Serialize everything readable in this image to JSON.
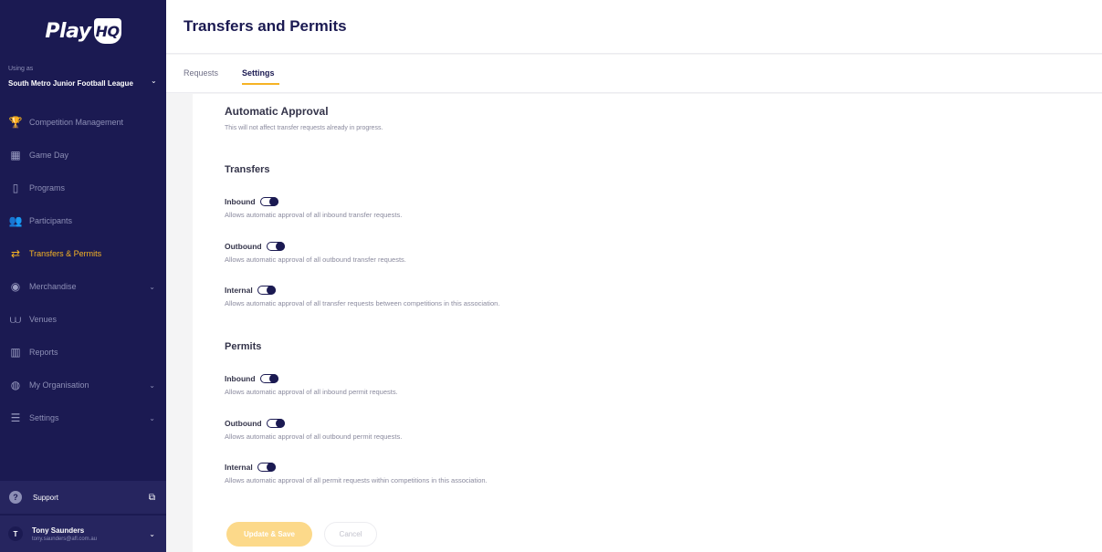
{
  "brand": {
    "logo_text": "Play",
    "logo_badge": "HQ",
    "accent": "#f6b324",
    "sidebar_bg": "#1b1a52"
  },
  "org": {
    "label": "Using as",
    "name": "South Metro Junior Football League"
  },
  "nav": [
    {
      "label": "Competition Management",
      "icon": "trophy-icon"
    },
    {
      "label": "Game Day",
      "icon": "scoreboard-icon"
    },
    {
      "label": "Programs",
      "icon": "book-icon"
    },
    {
      "label": "Participants",
      "icon": "people-icon"
    },
    {
      "label": "Transfers & Permits",
      "icon": "transfer-arrows-icon",
      "active": true
    },
    {
      "label": "Merchandise",
      "icon": "shirt-icon"
    },
    {
      "label": "Venues",
      "icon": "stadium-icon"
    },
    {
      "label": "Reports",
      "icon": "report-icon"
    },
    {
      "label": "My Organisation",
      "icon": "globe-icon"
    },
    {
      "label": "Settings",
      "icon": "sliders-icon"
    }
  ],
  "support": {
    "label": "Support"
  },
  "user": {
    "initial": "T",
    "name": "Tony Saunders",
    "email": "tony.saunders@afl.com.au"
  },
  "page": {
    "title": "Transfers and Permits"
  },
  "tabs": [
    {
      "label": "Requests"
    },
    {
      "label": "Settings",
      "active": true
    }
  ],
  "settings": {
    "heading": "Automatic Approval",
    "subtext": "This will not affect transfer requests already in progress.",
    "transfers": {
      "heading": "Transfers",
      "toggles": [
        {
          "label": "Inbound",
          "desc": "Allows automatic approval of all inbound transfer requests."
        },
        {
          "label": "Outbound",
          "desc": "Allows automatic approval of all outbound transfer requests."
        },
        {
          "label": "Internal",
          "desc": "Allows automatic approval of all transfer requests between competitions in this association."
        }
      ]
    },
    "permits": {
      "heading": "Permits",
      "toggles": [
        {
          "label": "Inbound",
          "desc": "Allows automatic approval of all inbound permit requests."
        },
        {
          "label": "Outbound",
          "desc": "Allows automatic approval of all outbound permit requests."
        },
        {
          "label": "Internal",
          "desc": "Allows automatic approval of all permit requests within competitions in this association."
        }
      ]
    }
  },
  "actions": {
    "update": "Update & Save",
    "cancel": "Cancel"
  }
}
